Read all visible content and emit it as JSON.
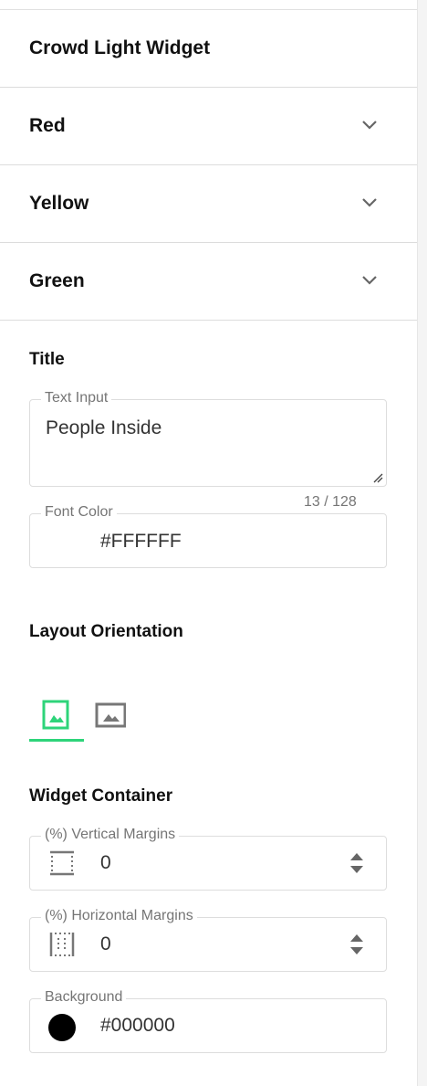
{
  "header": {
    "title": "Crowd Light Widget"
  },
  "accordions": [
    {
      "label": "Red"
    },
    {
      "label": "Yellow"
    },
    {
      "label": "Green"
    }
  ],
  "title_section": {
    "heading": "Title",
    "text_input": {
      "label": "Text Input",
      "value": "People Inside",
      "counter": "13 / 128"
    },
    "font_color": {
      "label": "Font Color",
      "value": "#FFFFFF"
    }
  },
  "layout": {
    "heading": "Layout Orientation",
    "options": [
      {
        "icon": "portrait-image-icon",
        "selected": true,
        "accent": "#2ed47a"
      },
      {
        "icon": "landscape-image-icon",
        "selected": false
      }
    ]
  },
  "container": {
    "heading": "Widget Container",
    "vertical_margins": {
      "label": "(%) Vertical Margins",
      "value": "0",
      "icon": "vertical-margins-icon"
    },
    "horizontal_margins": {
      "label": "(%) Horizontal Margins",
      "value": "0",
      "icon": "horizontal-margins-icon"
    },
    "background": {
      "label": "Background",
      "value": "#000000",
      "swatch": "#000000"
    }
  }
}
